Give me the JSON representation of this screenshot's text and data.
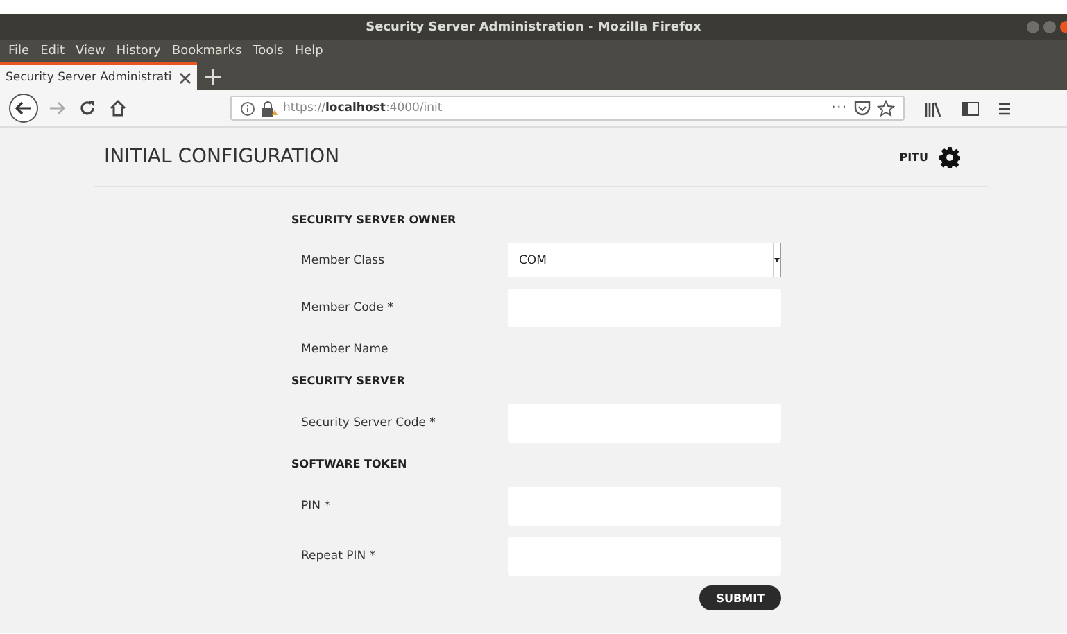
{
  "window": {
    "title": "Security Server Administration - Mozilla Firefox"
  },
  "menu": [
    "File",
    "Edit",
    "View",
    "History",
    "Bookmarks",
    "Tools",
    "Help"
  ],
  "tabs": [
    {
      "label": "Security Server Administrati",
      "selected": true
    }
  ],
  "address_bar": {
    "scheme": "https://",
    "host": "localhost",
    "rest": ":4000/init",
    "more": "···"
  },
  "page": {
    "title": "INITIAL CONFIGURATION",
    "user": "PITU",
    "sections": [
      {
        "heading": "SECURITY SERVER OWNER",
        "fields": [
          {
            "kind": "select",
            "label": "Member Class",
            "value": "COM"
          },
          {
            "kind": "text",
            "label": "Member Code *"
          },
          {
            "kind": "static",
            "label": "Member Name"
          }
        ]
      },
      {
        "heading": "SECURITY SERVER",
        "fields": [
          {
            "kind": "text",
            "label": "Security Server Code *"
          }
        ]
      },
      {
        "heading": "SOFTWARE TOKEN",
        "fields": [
          {
            "kind": "text",
            "label": "PIN *"
          },
          {
            "kind": "text",
            "label": "Repeat PIN *"
          }
        ]
      }
    ],
    "submit": "SUBMIT"
  }
}
